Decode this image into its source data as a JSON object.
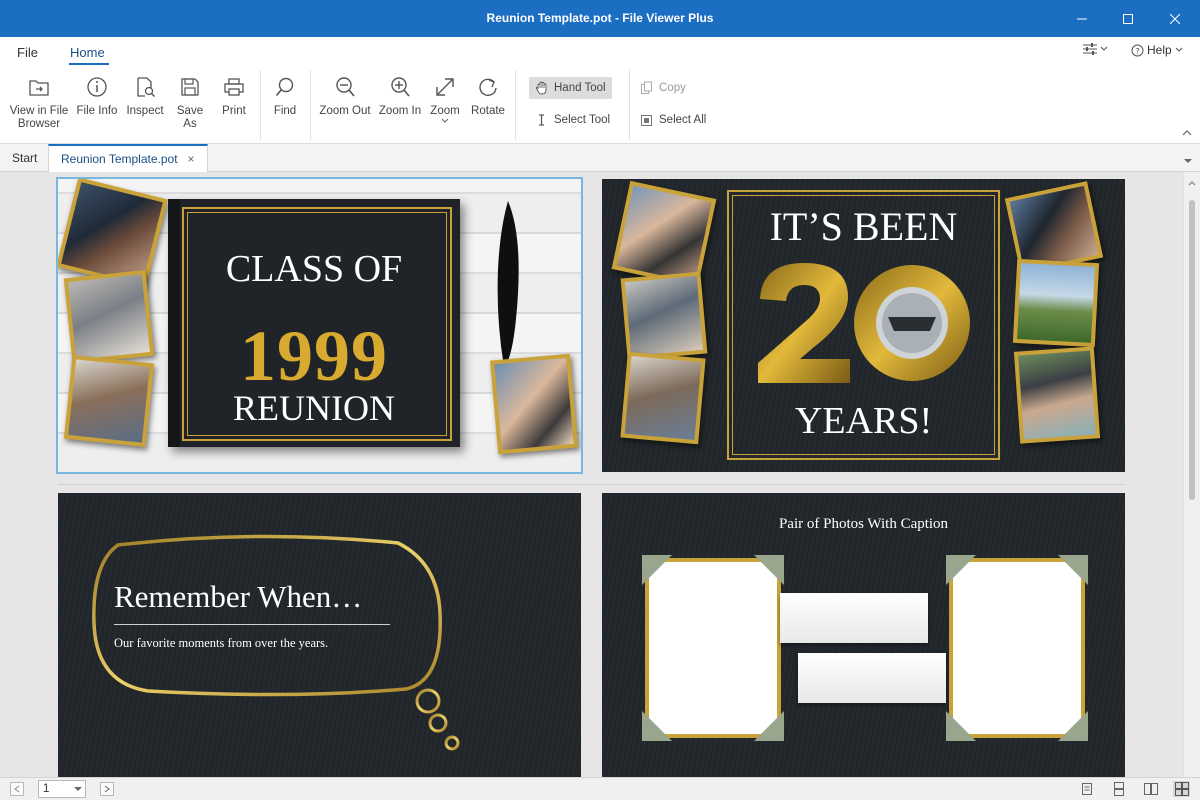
{
  "window": {
    "title": "Reunion Template.pot - File Viewer Plus"
  },
  "menu": {
    "file": "File",
    "home": "Home",
    "help": "Help"
  },
  "ribbon": {
    "view_in_file_browser_line1": "View in File",
    "view_in_file_browser_line2": "Browser",
    "file_info": "File Info",
    "inspect": "Inspect",
    "save_as": "Save As",
    "print": "Print",
    "find": "Find",
    "zoom_out": "Zoom Out",
    "zoom_in": "Zoom In",
    "zoom": "Zoom",
    "rotate": "Rotate",
    "hand_tool": "Hand Tool",
    "select_tool": "Select Tool",
    "copy": "Copy",
    "select_all": "Select All"
  },
  "tabs": [
    {
      "label": "Start"
    },
    {
      "label": "Reunion Template.pot",
      "close": "×"
    }
  ],
  "slides": {
    "s1": {
      "line1": "CLASS OF",
      "year": "1999",
      "line2": "REUNION"
    },
    "s2": {
      "line1": "IT’S BEEN",
      "number": "20",
      "line2": "YEARS!"
    },
    "s3": {
      "title": "Remember When…",
      "subtitle": "Our favorite moments from over the years."
    },
    "s4": {
      "caption": "Pair of Photos With Caption"
    }
  },
  "statusbar": {
    "page": "1"
  },
  "colors": {
    "titlebar": "#1b6ec2",
    "gold": "#c9a23a",
    "slide_bg": "#23272b"
  }
}
